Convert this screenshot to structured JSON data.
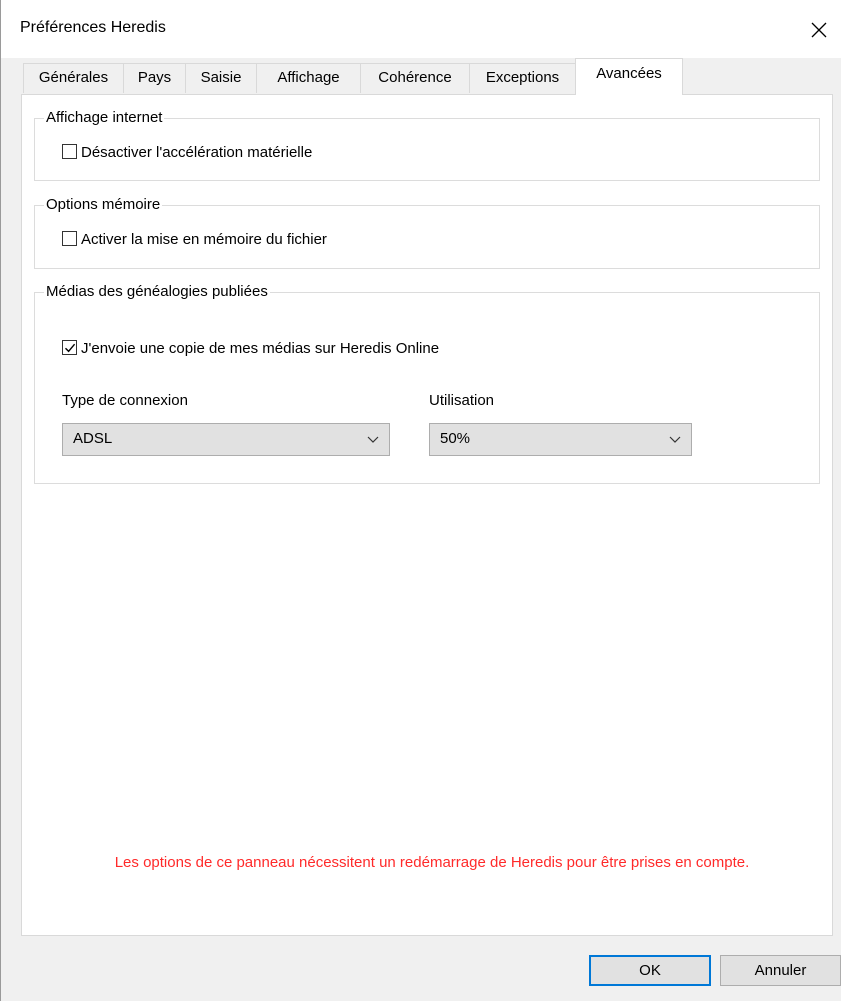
{
  "window": {
    "title": "Préférences Heredis",
    "close_label": "×"
  },
  "tabs": [
    {
      "label": "Générales",
      "active": false
    },
    {
      "label": "Pays",
      "active": false
    },
    {
      "label": "Saisie",
      "active": false
    },
    {
      "label": "Affichage",
      "active": false
    },
    {
      "label": "Cohérence",
      "active": false
    },
    {
      "label": "Exceptions",
      "active": false
    },
    {
      "label": "Avancées",
      "active": true
    }
  ],
  "groups": {
    "internet": {
      "title": "Affichage internet",
      "checkbox_label": "Désactiver l'accélération matérielle",
      "checked": false
    },
    "memory": {
      "title": "Options mémoire",
      "checkbox_label": "Activer la mise en mémoire du fichier",
      "checked": false
    },
    "media": {
      "title": "Médias des généalogies publiées",
      "checkbox_label": "J'envoie une copie de mes médias sur Heredis Online",
      "checked": true,
      "connection_label": "Type de connexion",
      "connection_value": "ADSL",
      "usage_label": "Utilisation",
      "usage_value": "50%"
    }
  },
  "notice": "Les options de ce panneau nécessitent un redémarrage de Heredis pour être prises en compte.",
  "buttons": {
    "ok": "OK",
    "cancel": "Annuler"
  },
  "colors": {
    "notice": "#ff2a2a",
    "default_button_border": "#0078d7"
  }
}
